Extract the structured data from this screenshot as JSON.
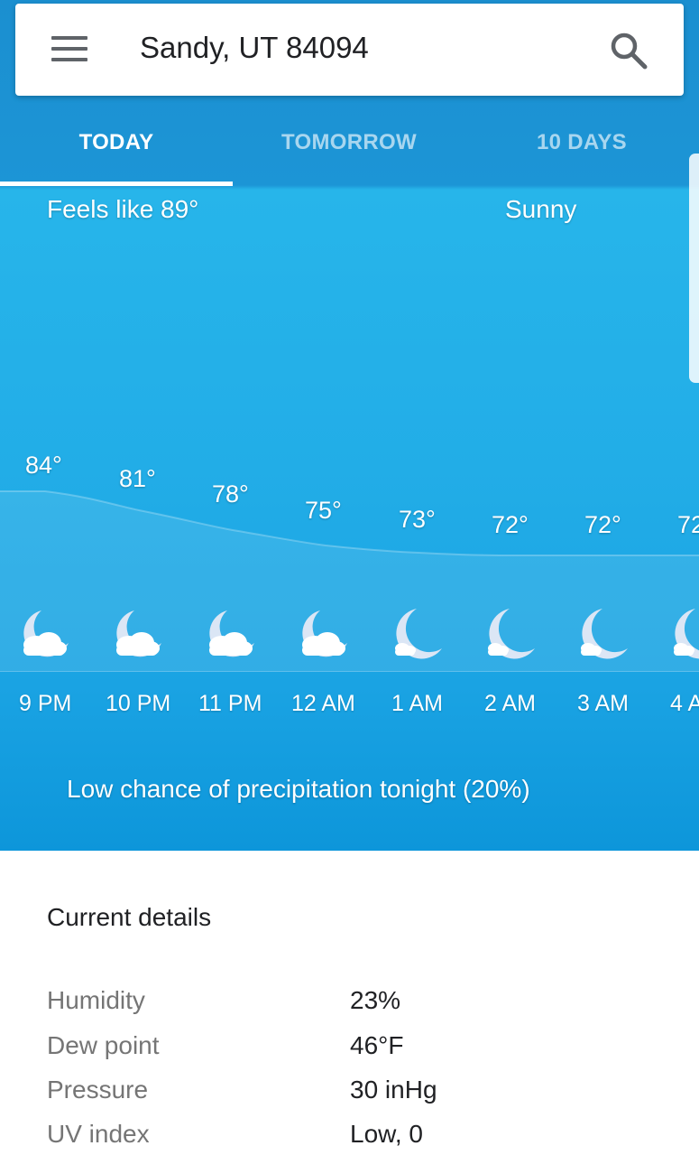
{
  "search": {
    "location": "Sandy, UT 84094"
  },
  "tabs": [
    {
      "label": "TODAY",
      "active": true
    },
    {
      "label": "TOMORROW",
      "active": false
    },
    {
      "label": "10 DAYS",
      "active": false
    }
  ],
  "summary": {
    "feels_like": "Feels like 89°",
    "condition": "Sunny"
  },
  "hourly": [
    {
      "time": "9 PM",
      "temp": "84°",
      "icon": "moon-cloud-icon"
    },
    {
      "time": "10 PM",
      "temp": "81°",
      "icon": "moon-cloud-icon"
    },
    {
      "time": "11 PM",
      "temp": "78°",
      "icon": "moon-cloud-icon"
    },
    {
      "time": "12 AM",
      "temp": "75°",
      "icon": "moon-cloud-icon"
    },
    {
      "time": "1 AM",
      "temp": "73°",
      "icon": "moon-small-cloud-icon"
    },
    {
      "time": "2 AM",
      "temp": "72°",
      "icon": "moon-small-cloud-icon"
    },
    {
      "time": "3 AM",
      "temp": "72°",
      "icon": "moon-small-cloud-icon"
    },
    {
      "time": "4 A",
      "temp": "72",
      "icon": "moon-small-cloud-icon"
    }
  ],
  "precipitation": "Low chance of precipitation tonight (20%)",
  "details": {
    "title": "Current details",
    "rows": [
      {
        "label": "Humidity",
        "value": "23%"
      },
      {
        "label": "Dew point",
        "value": "46°F"
      },
      {
        "label": "Pressure",
        "value": "30 inHg"
      },
      {
        "label": "UV index",
        "value": "Low, 0"
      }
    ]
  },
  "colors": {
    "sky_blue": "#22ade7",
    "header_blue": "#1b8fd0",
    "white": "#ffffff"
  }
}
